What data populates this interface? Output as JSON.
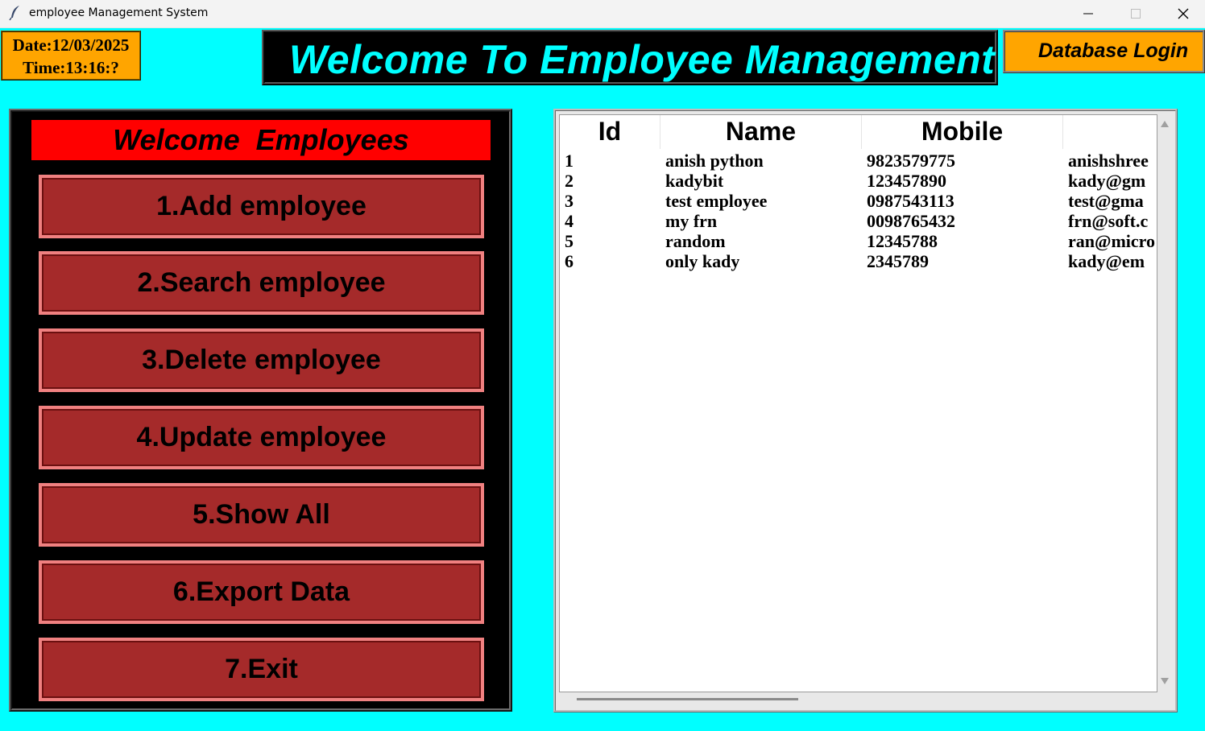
{
  "window": {
    "title": "employee Management System",
    "icon": "feather-icon"
  },
  "status": {
    "date": "Date:12/03/2025",
    "time": "Time:13:16:?"
  },
  "header": {
    "title": "Welcome To Employee Management",
    "db_login": "Database Login"
  },
  "menu": {
    "heading": "Welcome  Employees",
    "buttons": [
      "1.Add employee",
      "2.Search employee",
      "3.Delete employee",
      "4.Update employee",
      "5.Show All",
      "6.Export Data",
      "7.Exit"
    ]
  },
  "table": {
    "columns": [
      "Id",
      "Name",
      "Mobile"
    ],
    "rows": [
      [
        "1",
        "anish python",
        "9823579775",
        "anishshree"
      ],
      [
        "2",
        "kadybit",
        "123457890",
        "kady@gm"
      ],
      [
        "3",
        "test employee",
        "0987543113",
        "test@gma"
      ],
      [
        "4",
        "my frn",
        "0098765432",
        "frn@soft.c"
      ],
      [
        "5",
        "random",
        "12345788",
        "ran@micro"
      ],
      [
        "6",
        "only kady",
        "2345789",
        "kady@em"
      ]
    ]
  },
  "colors": {
    "background": "#00ffff",
    "accent_orange": "#ffa500",
    "button_brown": "#a52a2a",
    "heading_red": "#ff0000",
    "banner_text": "#00ffff"
  }
}
